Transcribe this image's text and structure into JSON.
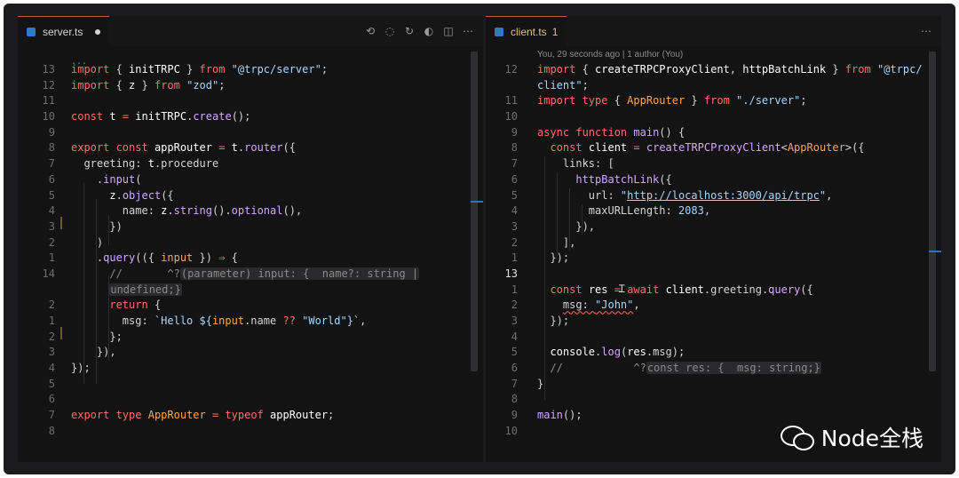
{
  "left_editor": {
    "tab_label": "server.ts",
    "tab_unsaved": true,
    "actions": [
      "git-compare-icon",
      "circle-dot-icon",
      "arrow-circle-icon",
      "sync-icon",
      "split-editor-icon",
      "more-icon"
    ],
    "folded_marker": "...",
    "lines": [
      {
        "n": "13",
        "html": "<span class='k'>import</span> { <span class='v'>initTRPC</span> } <span class='k'>from</span> <span class='s'>\"@trpc/server\"</span>;"
      },
      {
        "n": "12",
        "html": "<span class='k'>import</span> { <span class='v'>z</span> } <span class='k'>from</span> <span class='s'>\"zod\"</span>;"
      },
      {
        "n": "11",
        "html": ""
      },
      {
        "n": "10",
        "html": "<span class='k'>const</span> <span class='v'>t</span> <span class='k'>=</span> <span class='v'>initTRPC</span>.<span class='f'>create</span>();"
      },
      {
        "n": "9",
        "html": ""
      },
      {
        "n": "8",
        "html": "<span class='k'>export const</span> <span class='v'>appRouter</span> <span class='k'>=</span> <span class='v'>t</span>.<span class='f'>router</span>({"
      },
      {
        "n": "7",
        "html": "  greeting: <span class='v'>t</span>.procedure"
      },
      {
        "n": "6",
        "html": "    .<span class='f'>input</span>("
      },
      {
        "n": "5",
        "html": "      <span class='v'>z</span>.<span class='f'>object</span>({"
      },
      {
        "n": "4",
        "html": "        name: <span class='v'>z</span>.<span class='f'>string</span>().<span class='f'>optional</span>(),"
      },
      {
        "n": "3",
        "html": "      })"
      },
      {
        "n": "2",
        "html": "    )"
      },
      {
        "n": "1",
        "html": "    .<span class='f'>query</span>(({ <span class='ty'>input</span> }) <span class='k'>⇒</span> {"
      },
      {
        "n": "14",
        "html": "      <span class='c'>//       ^?</span><span class='hint'>(parameter) input: {  name?: string |</span>",
        "active": false
      },
      {
        "n": "",
        "html": "      <span class='hint'>undefined;}</span>"
      },
      {
        "n": "2",
        "html": "      <span class='k'>return</span> {"
      },
      {
        "n": "1",
        "html": "        msg: <span class='s'>`Hello ${</span><span class='ty'>input</span>.name <span class='k'>??</span> <span class='s'>\"World\"</span><span class='s'>}`</span>,"
      },
      {
        "n": "2",
        "html": "      };"
      },
      {
        "n": "3",
        "html": "    }),"
      },
      {
        "n": "4",
        "html": "});"
      },
      {
        "n": "5",
        "html": ""
      },
      {
        "n": "6",
        "html": ""
      },
      {
        "n": "7",
        "html": "<span class='k'>export type</span> <span class='ty'>AppRouter</span> <span class='k'>= typeof</span> <span class='v'>appRouter</span>;"
      },
      {
        "n": "8",
        "html": ""
      }
    ]
  },
  "right_editor": {
    "tab_label": "client.ts",
    "tab_problems": "1",
    "blame": "You, 29 seconds ago | 1 author (You)",
    "actions": [
      "more-icon"
    ],
    "lines": [
      {
        "n": "12",
        "html": "<span class='k'>import</span> { <span class='v'>createTRPCProxyClient</span>, <span class='v'>httpBatchLink</span> } <span class='k'>from</span> <span class='s'>\"@trpc/</span>"
      },
      {
        "n": "",
        "html": "<span class='s'>client\"</span>;"
      },
      {
        "n": "11",
        "html": "<span class='k'>import type</span> { <span class='ty'>AppRouter</span> } <span class='k'>from</span> <span class='s'>\"./server\"</span>;"
      },
      {
        "n": "10",
        "html": ""
      },
      {
        "n": "9",
        "html": "<span class='k'>async function</span> <span class='f'>main</span>() {"
      },
      {
        "n": "8",
        "html": "  <span class='k'>const</span> <span class='v'>client</span> <span class='k'>=</span> <span class='f'>createTRPCProxyClient</span><<span class='ty'>AppRouter</span>>({"
      },
      {
        "n": "7",
        "html": "    links: ["
      },
      {
        "n": "6",
        "html": "      <span class='f'>httpBatchLink</span>({"
      },
      {
        "n": "5",
        "html": "        url: <span class='s'>\"</span><span class='url'>http://localhost:3000/api/trpc</span><span class='s'>\"</span>,"
      },
      {
        "n": "4",
        "html": "        maxURLLength: <span class='s'>2083</span>,"
      },
      {
        "n": "3",
        "html": "      }),"
      },
      {
        "n": "2",
        "html": "    ],"
      },
      {
        "n": "1",
        "html": "  });"
      },
      {
        "n": "13",
        "html": "",
        "active": true
      },
      {
        "n": "1",
        "html": "  <span class='k'>const</span> <span class='v'>res</span> <span class='k'>=</span> <span class='k'>await</span> <span class='v'>client</span>.greeting.<span class='f'>query</span>({"
      },
      {
        "n": "2",
        "html": "    <span class='squiggle'>msg: <span class='s'>\"John\"</span></span>,"
      },
      {
        "n": "3",
        "html": "  });"
      },
      {
        "n": "4",
        "html": ""
      },
      {
        "n": "5",
        "html": "  <span class='v'>console</span>.<span class='f'>log</span>(<span class='v'>res</span>.msg);"
      },
      {
        "n": "6",
        "html": "  <span class='c'>//           ^?</span><span class='hint'>const res: {  msg: string;}</span>"
      },
      {
        "n": "7",
        "html": "}"
      },
      {
        "n": "8",
        "html": ""
      },
      {
        "n": "9",
        "html": "<span class='f'>main</span>();"
      },
      {
        "n": "10",
        "html": ""
      }
    ]
  },
  "watermark": {
    "icon": "wechat-icon",
    "text": "Node全栈"
  }
}
